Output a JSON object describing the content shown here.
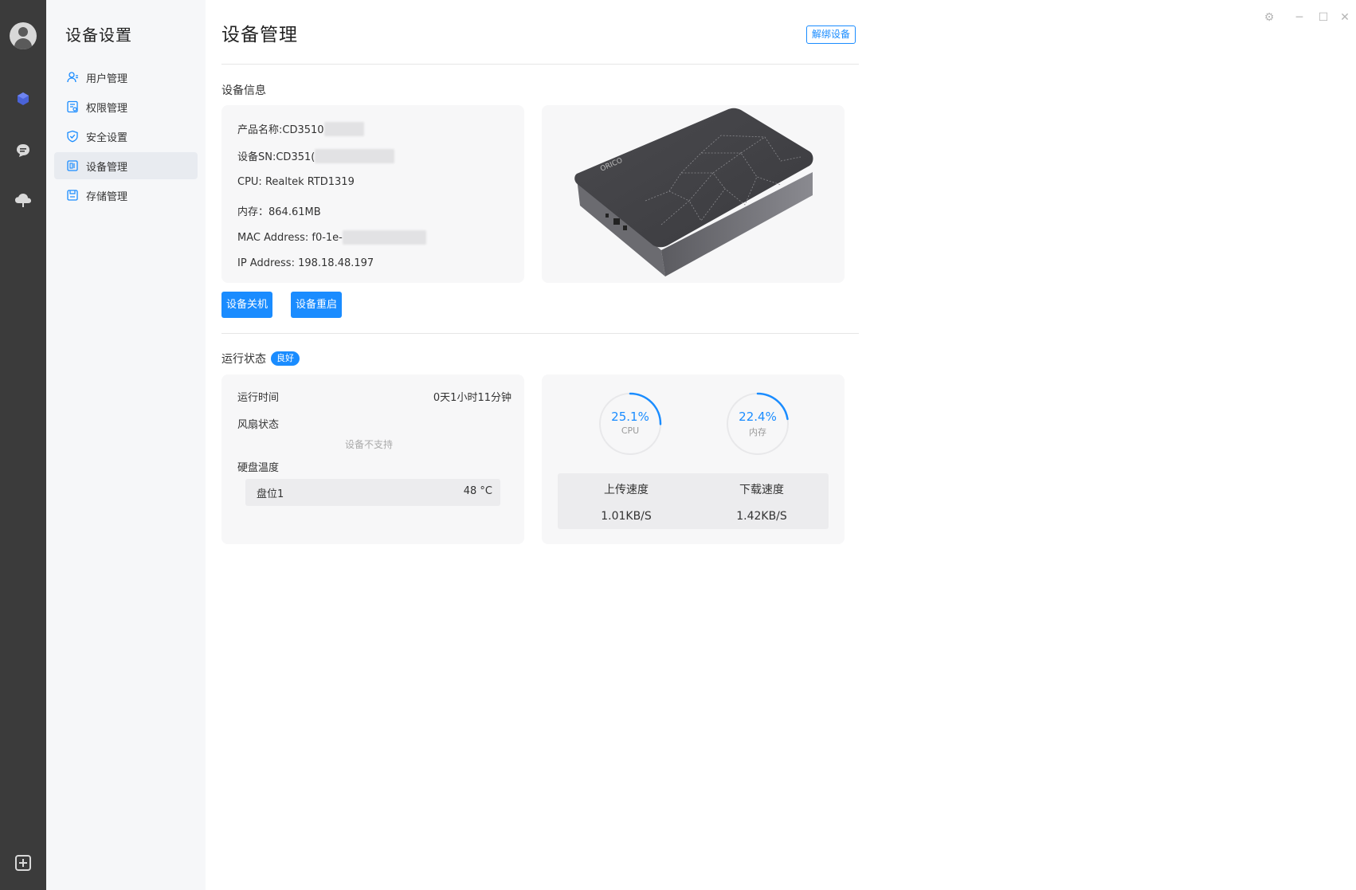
{
  "window": {
    "settings_glyph": "⚙",
    "minimize_glyph": "─",
    "maximize_glyph": "☐",
    "close_glyph": "✕"
  },
  "rail": {
    "items": [
      "avatar",
      "cube-icon",
      "chat-icon",
      "cloud-icon",
      "add-box-icon"
    ]
  },
  "sidebar": {
    "title": "设备设置",
    "items": [
      {
        "label": "用户管理",
        "icon": "user-icon",
        "active": false
      },
      {
        "label": "权限管理",
        "icon": "permission-icon",
        "active": false
      },
      {
        "label": "安全设置",
        "icon": "shield-icon",
        "active": false
      },
      {
        "label": "设备管理",
        "icon": "device-icon",
        "active": true
      },
      {
        "label": "存储管理",
        "icon": "storage-icon",
        "active": false
      }
    ]
  },
  "main": {
    "title": "设备管理",
    "unbind_label": "解绑设备",
    "device_info": {
      "section_title": "设备信息",
      "product_name": "产品名称:CD3510",
      "device_sn": "设备SN:CD351(",
      "cpu": "CPU: Realtek RTD1319",
      "memory": "内存：864.61MB",
      "mac": "MAC Address: f0-1e-",
      "ip": "IP Address: 198.18.48.197"
    },
    "shutdown_label": "设备关机",
    "reboot_label": "设备重启",
    "status": {
      "section_title": "运行状态",
      "badge": "良好",
      "uptime_label": "运行时间",
      "uptime_value": "0天1小时11分钟",
      "fan_label": "风扇状态",
      "fan_value": "设备不支持",
      "disk_temp_label": "硬盘温度",
      "disk_name": "盘位1",
      "disk_temp": "48 °C"
    },
    "gauges": [
      {
        "value": 25.1,
        "text": "25.1%",
        "label": "CPU"
      },
      {
        "value": 22.4,
        "text": "22.4%",
        "label": "内存"
      }
    ],
    "speed": {
      "upload_label": "上传速度",
      "upload_value": "1.01KB/S",
      "download_label": "下载速度",
      "download_value": "1.42KB/S"
    },
    "colors": {
      "accent": "#1a8cff",
      "rail": "#3b3b3b",
      "sidebar": "#f6f7f9",
      "card": "#f7f7f8"
    }
  }
}
